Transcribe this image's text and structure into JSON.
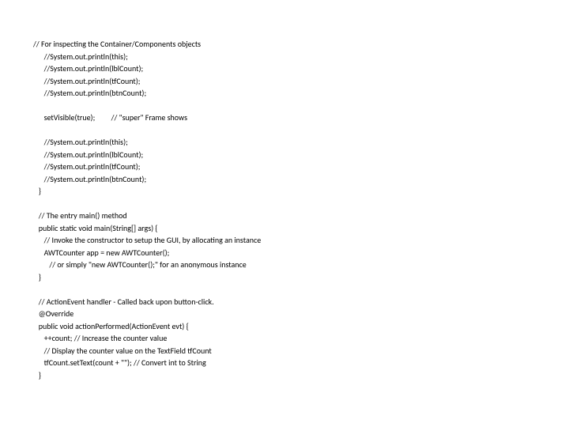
{
  "lines": [
    "// For inspecting the Container/Components objects",
    "      //System.out.println(this);",
    "      //System.out.println(lblCount);",
    "      //System.out.println(tfCount);",
    "      //System.out.println(btnCount);",
    "",
    "      setVisible(true);         // \"super\" Frame shows",
    "",
    "      //System.out.println(this);",
    "      //System.out.println(lblCount);",
    "      //System.out.println(tfCount);",
    "      //System.out.println(btnCount);",
    "   }",
    "",
    "   // The entry main() method",
    "   public static void main(String[] args) {",
    "      // Invoke the constructor to setup the GUI, by allocating an instance",
    "      AWTCounter app = new AWTCounter();",
    "         // or simply \"new AWTCounter();\" for an anonymous instance",
    "   }",
    "",
    "   // ActionEvent handler - Called back upon button-click.",
    "   @Override",
    "   public void actionPerformed(ActionEvent evt) {",
    "      ++count; // Increase the counter value",
    "      // Display the counter value on the TextField tfCount",
    "      tfCount.setText(count + \"\"); // Convert int to String",
    "   }"
  ]
}
